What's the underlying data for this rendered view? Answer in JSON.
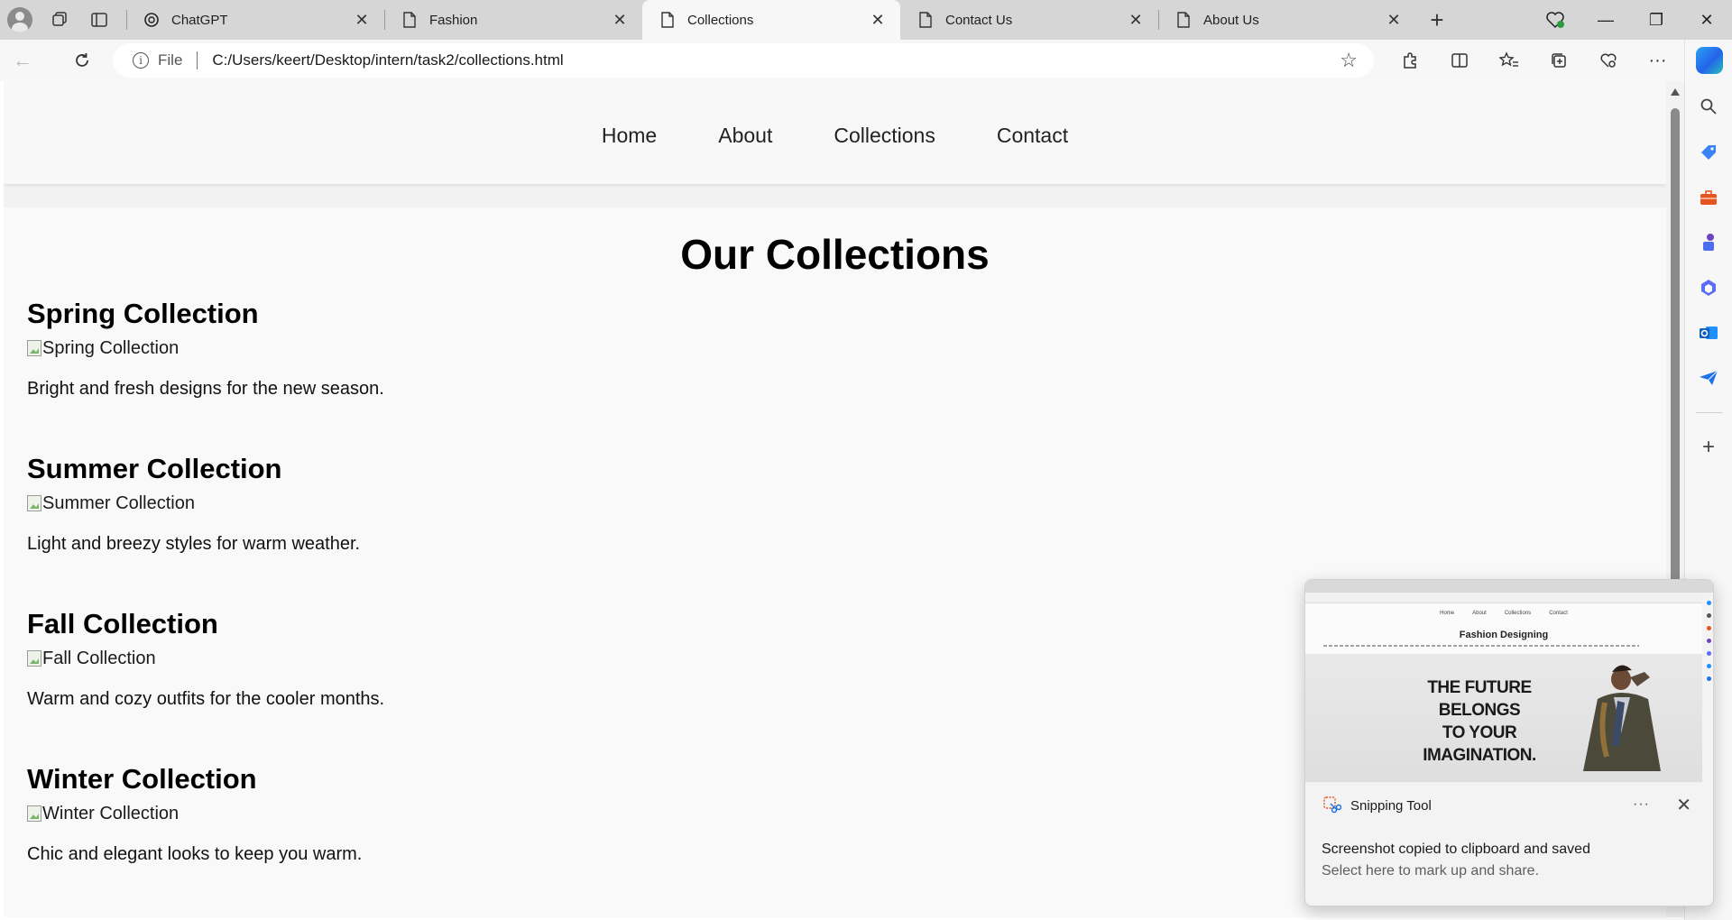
{
  "browser": {
    "tabs": [
      {
        "title": "ChatGPT",
        "icon": "chatgpt-icon",
        "active": false
      },
      {
        "title": "Fashion",
        "icon": "page-icon",
        "active": false
      },
      {
        "title": "Collections",
        "icon": "page-icon",
        "active": true
      },
      {
        "title": "Contact Us",
        "icon": "page-icon",
        "active": false
      },
      {
        "title": "About Us",
        "icon": "page-icon",
        "active": false
      }
    ],
    "address": {
      "scheme_label": "File",
      "url": "C:/Users/keert/Desktop/intern/task2/collections.html"
    }
  },
  "site": {
    "nav": [
      "Home",
      "About",
      "Collections",
      "Contact"
    ],
    "page_title": "Our Collections",
    "collections": [
      {
        "title": "Spring Collection",
        "img_alt": "Spring Collection",
        "description": "Bright and fresh designs for the new season."
      },
      {
        "title": "Summer Collection",
        "img_alt": "Summer Collection",
        "description": "Light and breezy styles for warm weather."
      },
      {
        "title": "Fall Collection",
        "img_alt": "Fall Collection",
        "description": "Warm and cozy outfits for the cooler months."
      },
      {
        "title": "Winter Collection",
        "img_alt": "Winter Collection",
        "description": "Chic and elegant looks to keep you warm."
      }
    ]
  },
  "toast": {
    "app_name": "Snipping Tool",
    "message": "Screenshot copied to clipboard and saved",
    "sub_message": "Select here to mark up and share.",
    "thumbnail": {
      "nav": [
        "Home",
        "About",
        "Collections",
        "Contact"
      ],
      "heading": "Fashion Designing",
      "hero_lines": [
        "THE FUTURE",
        "BELONGS",
        "TO YOUR",
        "IMAGINATION."
      ]
    }
  },
  "colors": {
    "copilot_blue": "#2463eb",
    "tab_strip": "#d6d6d6",
    "active_tab": "#f7f7f7"
  }
}
